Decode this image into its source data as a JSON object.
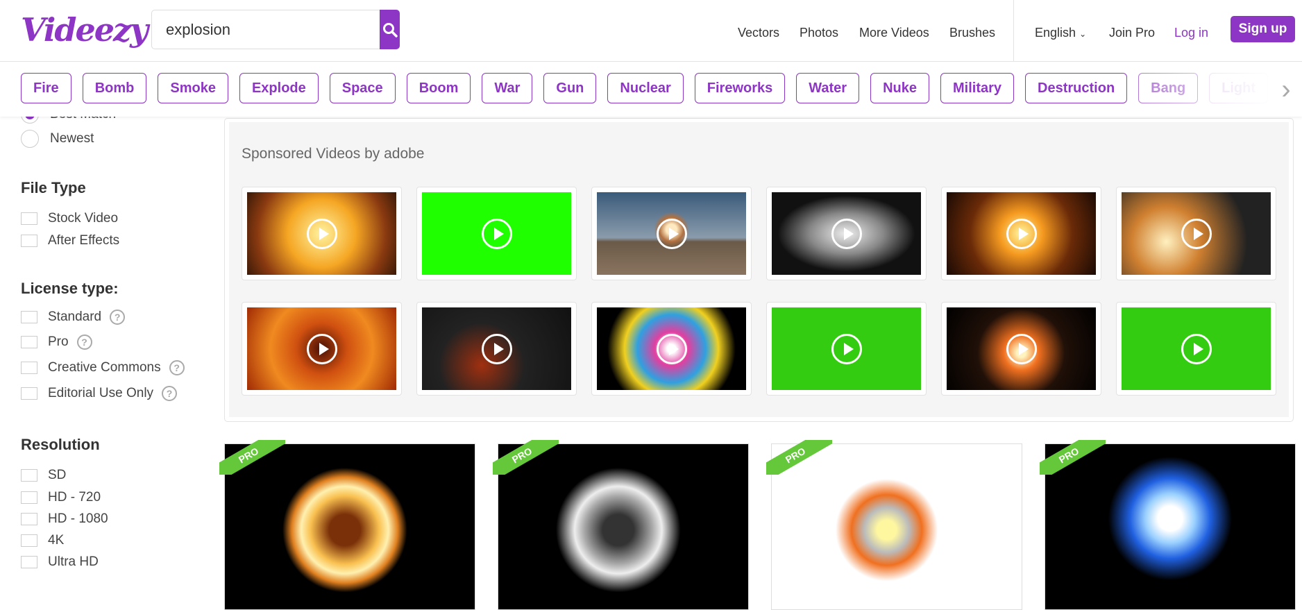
{
  "header": {
    "logo": "Videezy",
    "search_value": "explosion",
    "nav": [
      "Vectors",
      "Photos",
      "More Videos",
      "Brushes"
    ],
    "language": "English",
    "join_pro": "Join Pro",
    "login": "Log in",
    "signup": "Sign up"
  },
  "tags": [
    "Fire",
    "Bomb",
    "Smoke",
    "Explode",
    "Space",
    "Boom",
    "War",
    "Gun",
    "Nuclear",
    "Fireworks",
    "Water",
    "Nuke",
    "Military",
    "Destruction",
    "Bang",
    "Light"
  ],
  "sidebar": {
    "sort": [
      {
        "label": "Best Match",
        "selected": true
      },
      {
        "label": "Newest",
        "selected": false
      }
    ],
    "file_type": {
      "title": "File Type",
      "options": [
        "Stock Video",
        "After Effects"
      ]
    },
    "license": {
      "title": "License type:",
      "options": [
        "Standard",
        "Pro",
        "Creative Commons",
        "Editorial Use Only"
      ]
    },
    "resolution": {
      "title": "Resolution",
      "options": [
        "SD",
        "HD - 720",
        "HD - 1080",
        "4K",
        "Ultra HD"
      ]
    }
  },
  "sponsored": {
    "title": "Sponsored Videos by adobe"
  },
  "pro_badge": "PRO",
  "colors": {
    "brand": "#8d35c4",
    "pro": "#65c73a"
  }
}
